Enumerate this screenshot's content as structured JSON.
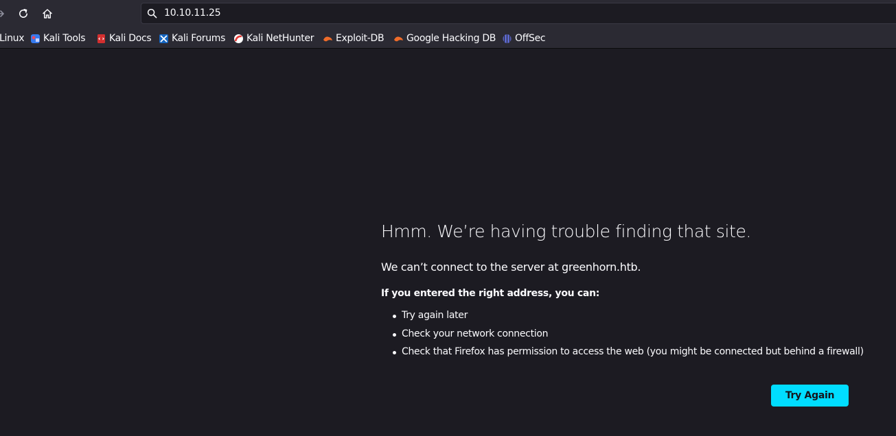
{
  "browser": {
    "url": "10.10.11.25",
    "nav": {
      "forward_icon": "arrow-right-icon",
      "reload_icon": "reload-icon",
      "home_icon": "home-icon",
      "search_icon": "search-icon"
    }
  },
  "bookmarks": [
    {
      "label": "Linux",
      "icon": "none"
    },
    {
      "label": "Kali Tools",
      "icon": "kali-tools-icon"
    },
    {
      "label": "Kali Docs",
      "icon": "kali-docs-icon"
    },
    {
      "label": "Kali Forums",
      "icon": "kali-forums-icon"
    },
    {
      "label": "Kali NetHunter",
      "icon": "kali-nethunter-icon"
    },
    {
      "label": "Exploit-DB",
      "icon": "exploit-db-icon"
    },
    {
      "label": "Google Hacking DB",
      "icon": "ghdb-icon"
    },
    {
      "label": "OffSec",
      "icon": "offsec-icon"
    }
  ],
  "error_page": {
    "title": "Hmm. We’re having trouble finding that site.",
    "description": "We can’t connect to the server at greenhorn.htb.",
    "subtitle": "If you entered the right address, you can:",
    "suggestions": [
      "Try again later",
      "Check your network connection",
      "Check that Firefox has permission to access the web (you might be connected but behind a firewall)"
    ],
    "button_label": "Try Again"
  },
  "colors": {
    "page_background": "#1c1b22",
    "toolbar_background": "#2b2a33",
    "button_accent": "#00ddff",
    "text": "#fbfbfe"
  }
}
